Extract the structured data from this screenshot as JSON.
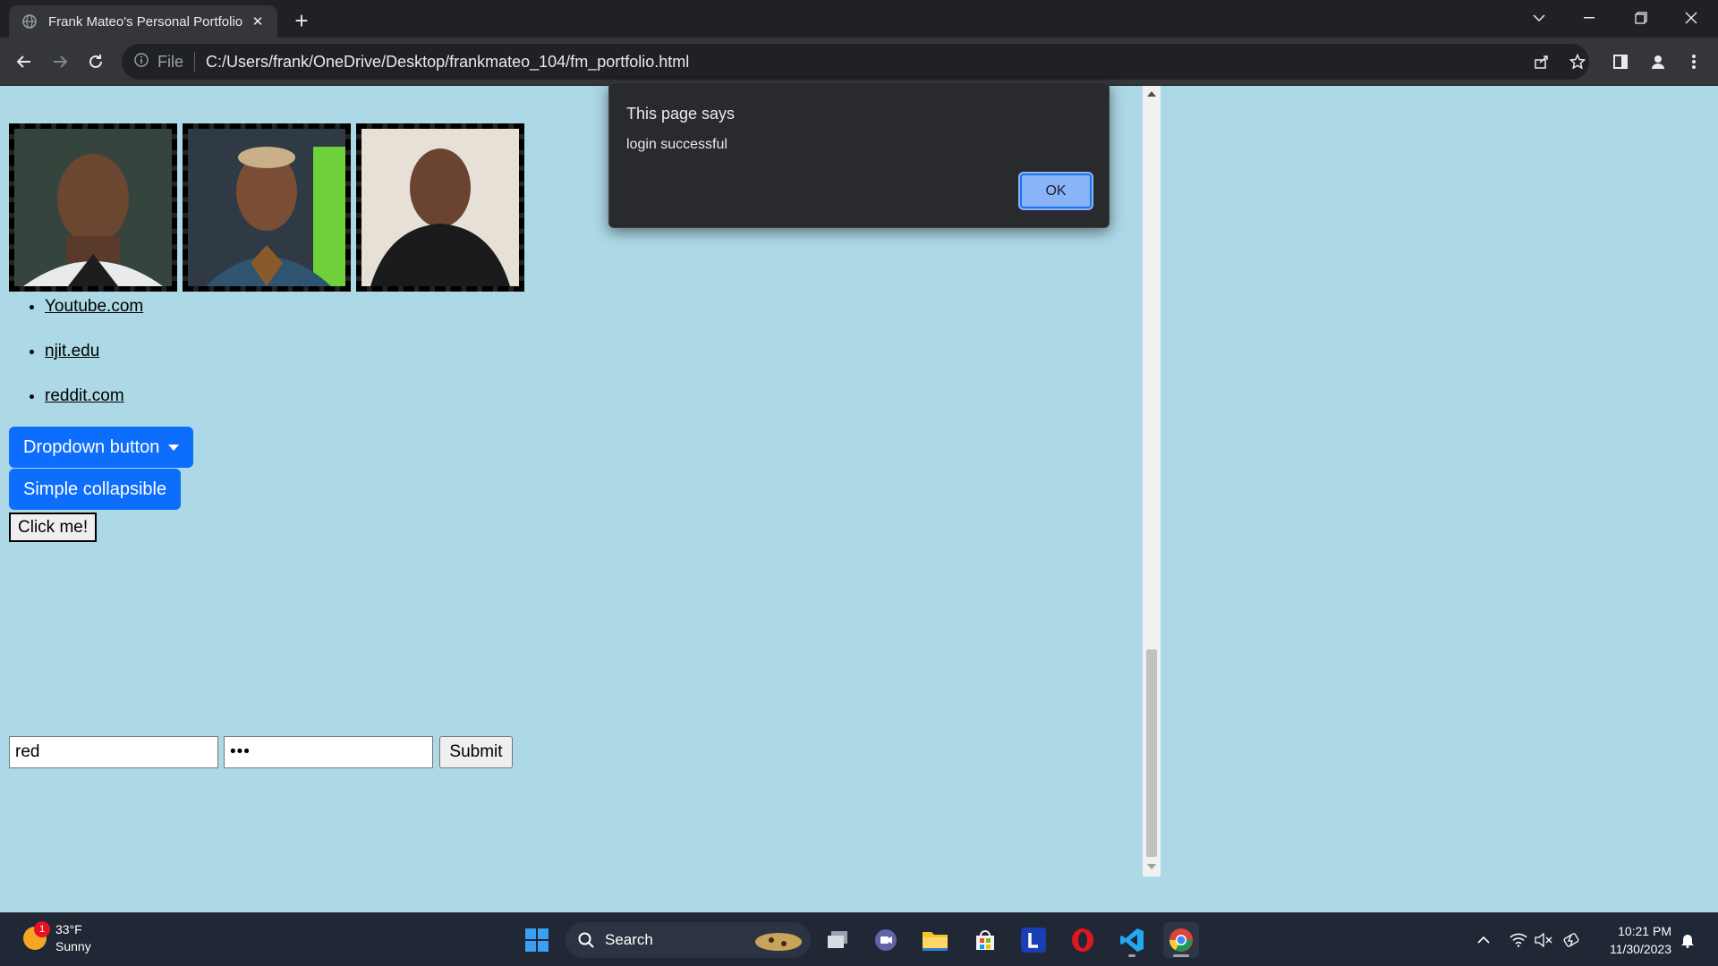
{
  "browser": {
    "tab_title": "Frank Mateo's Personal Portfolio",
    "address_scheme": "File",
    "address_url": "C:/Users/frank/OneDrive/Desktop/frankmateo_104/fm_portfolio.html"
  },
  "page": {
    "photos": [
      {
        "name": "photo-1"
      },
      {
        "name": "photo-2"
      },
      {
        "name": "photo-3"
      }
    ],
    "links": [
      "Youtube.com",
      "njit.edu",
      "reddit.com"
    ],
    "dropdown_label": "Dropdown button",
    "collapsible_label": "Simple collapsible",
    "click_me_label": "Click me!",
    "username_value": "red",
    "password_value": "•••",
    "submit_label": "Submit",
    "background_color": "#add8e6",
    "primary_color": "#0d6efd"
  },
  "dialog": {
    "title": "This page says",
    "message": "login successful",
    "ok_label": "OK"
  },
  "taskbar": {
    "weather_temp": "33°F",
    "weather_desc": "Sunny",
    "weather_badge": "1",
    "search_label": "Search",
    "time": "10:21 PM",
    "date": "11/30/2023"
  }
}
